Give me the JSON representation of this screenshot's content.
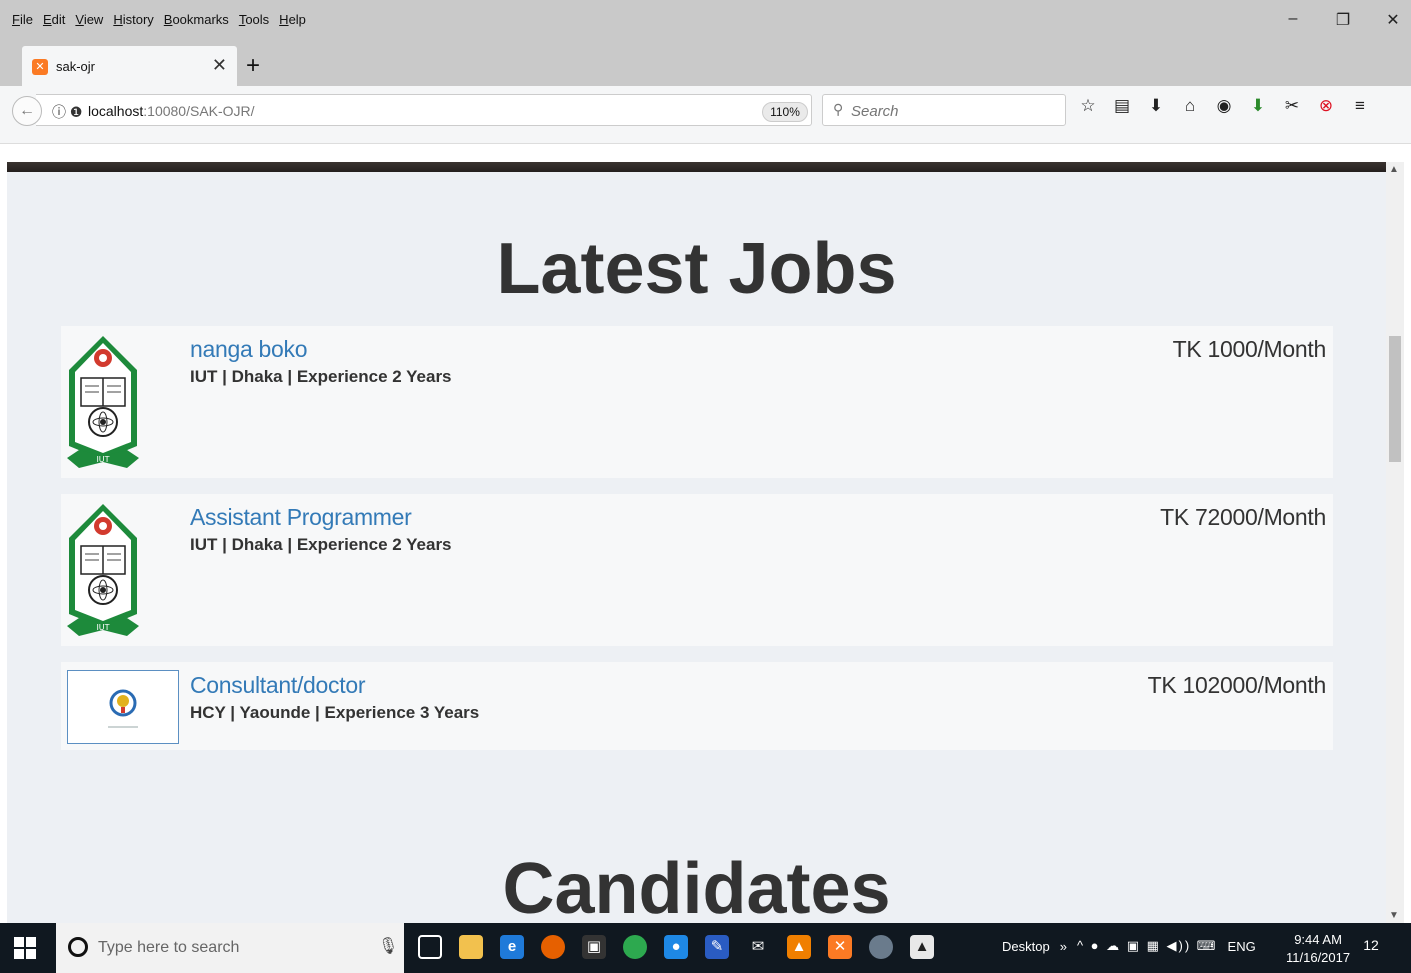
{
  "menu": {
    "items": [
      "File",
      "Edit",
      "View",
      "History",
      "Bookmarks",
      "Tools",
      "Help"
    ]
  },
  "window_controls": {
    "minimize": "–",
    "restore": "❐",
    "close": "✕"
  },
  "tab": {
    "title": "sak-ojr",
    "favicon": "xampp-icon",
    "close_label": "✕",
    "new_tab_label": "+"
  },
  "navbar": {
    "url_host": "localhost",
    "url_rest": ":10080/SAK-OJR/",
    "zoom": "110%",
    "search_placeholder": "Search"
  },
  "page": {
    "latest_jobs_title": "Latest Jobs",
    "candidates_title": "Candidates",
    "jobs": [
      {
        "title": "nanga boko",
        "company": "IUT",
        "location": "Dhaka",
        "experience": "Experience 2 Years",
        "meta": "IUT | Dhaka | Experience 2 Years",
        "salary": "TK 1000/Month",
        "logo": "iut-logo"
      },
      {
        "title": "Assistant Programmer",
        "company": "IUT",
        "location": "Dhaka",
        "experience": "Experience 2 Years",
        "meta": "IUT | Dhaka | Experience 2 Years",
        "salary": "TK 72000/Month",
        "logo": "iut-logo"
      },
      {
        "title": "Consultant/doctor",
        "company": "HCY",
        "location": "Yaounde",
        "experience": "Experience 3 Years",
        "meta": "HCY | Yaounde | Experience 3 Years",
        "salary": "TK 102000/Month",
        "logo": "hcy-logo"
      }
    ]
  },
  "taskbar": {
    "search_placeholder": "Type here to search",
    "desktop_label": "Desktop",
    "language": "ENG",
    "time": "9:44 AM",
    "date": "11/16/2017",
    "notifications": "12"
  },
  "colors": {
    "link_blue": "#337ab7",
    "heading": "#333333",
    "page_bg": "#edf0f4",
    "card_bg": "#f7f8f9",
    "iut_green": "#1d8a3b"
  }
}
